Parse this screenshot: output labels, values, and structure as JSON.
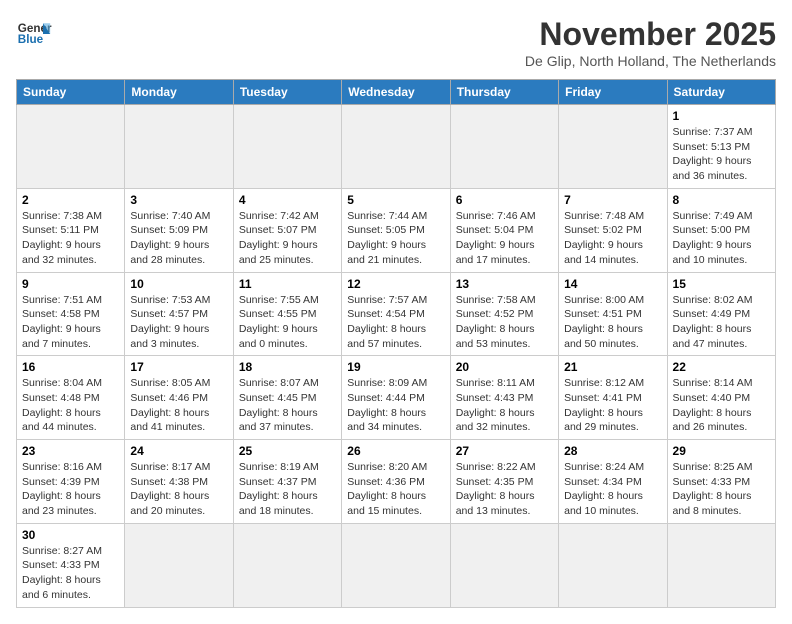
{
  "logo": {
    "text_general": "General",
    "text_blue": "Blue"
  },
  "header": {
    "title": "November 2025",
    "location": "De Glip, North Holland, The Netherlands"
  },
  "weekdays": [
    "Sunday",
    "Monday",
    "Tuesday",
    "Wednesday",
    "Thursday",
    "Friday",
    "Saturday"
  ],
  "days": {
    "d1": {
      "num": "1",
      "info": "Sunrise: 7:37 AM\nSunset: 5:13 PM\nDaylight: 9 hours and 36 minutes."
    },
    "d2": {
      "num": "2",
      "info": "Sunrise: 7:38 AM\nSunset: 5:11 PM\nDaylight: 9 hours and 32 minutes."
    },
    "d3": {
      "num": "3",
      "info": "Sunrise: 7:40 AM\nSunset: 5:09 PM\nDaylight: 9 hours and 28 minutes."
    },
    "d4": {
      "num": "4",
      "info": "Sunrise: 7:42 AM\nSunset: 5:07 PM\nDaylight: 9 hours and 25 minutes."
    },
    "d5": {
      "num": "5",
      "info": "Sunrise: 7:44 AM\nSunset: 5:05 PM\nDaylight: 9 hours and 21 minutes."
    },
    "d6": {
      "num": "6",
      "info": "Sunrise: 7:46 AM\nSunset: 5:04 PM\nDaylight: 9 hours and 17 minutes."
    },
    "d7": {
      "num": "7",
      "info": "Sunrise: 7:48 AM\nSunset: 5:02 PM\nDaylight: 9 hours and 14 minutes."
    },
    "d8": {
      "num": "8",
      "info": "Sunrise: 7:49 AM\nSunset: 5:00 PM\nDaylight: 9 hours and 10 minutes."
    },
    "d9": {
      "num": "9",
      "info": "Sunrise: 7:51 AM\nSunset: 4:58 PM\nDaylight: 9 hours and 7 minutes."
    },
    "d10": {
      "num": "10",
      "info": "Sunrise: 7:53 AM\nSunset: 4:57 PM\nDaylight: 9 hours and 3 minutes."
    },
    "d11": {
      "num": "11",
      "info": "Sunrise: 7:55 AM\nSunset: 4:55 PM\nDaylight: 9 hours and 0 minutes."
    },
    "d12": {
      "num": "12",
      "info": "Sunrise: 7:57 AM\nSunset: 4:54 PM\nDaylight: 8 hours and 57 minutes."
    },
    "d13": {
      "num": "13",
      "info": "Sunrise: 7:58 AM\nSunset: 4:52 PM\nDaylight: 8 hours and 53 minutes."
    },
    "d14": {
      "num": "14",
      "info": "Sunrise: 8:00 AM\nSunset: 4:51 PM\nDaylight: 8 hours and 50 minutes."
    },
    "d15": {
      "num": "15",
      "info": "Sunrise: 8:02 AM\nSunset: 4:49 PM\nDaylight: 8 hours and 47 minutes."
    },
    "d16": {
      "num": "16",
      "info": "Sunrise: 8:04 AM\nSunset: 4:48 PM\nDaylight: 8 hours and 44 minutes."
    },
    "d17": {
      "num": "17",
      "info": "Sunrise: 8:05 AM\nSunset: 4:46 PM\nDaylight: 8 hours and 41 minutes."
    },
    "d18": {
      "num": "18",
      "info": "Sunrise: 8:07 AM\nSunset: 4:45 PM\nDaylight: 8 hours and 37 minutes."
    },
    "d19": {
      "num": "19",
      "info": "Sunrise: 8:09 AM\nSunset: 4:44 PM\nDaylight: 8 hours and 34 minutes."
    },
    "d20": {
      "num": "20",
      "info": "Sunrise: 8:11 AM\nSunset: 4:43 PM\nDaylight: 8 hours and 32 minutes."
    },
    "d21": {
      "num": "21",
      "info": "Sunrise: 8:12 AM\nSunset: 4:41 PM\nDaylight: 8 hours and 29 minutes."
    },
    "d22": {
      "num": "22",
      "info": "Sunrise: 8:14 AM\nSunset: 4:40 PM\nDaylight: 8 hours and 26 minutes."
    },
    "d23": {
      "num": "23",
      "info": "Sunrise: 8:16 AM\nSunset: 4:39 PM\nDaylight: 8 hours and 23 minutes."
    },
    "d24": {
      "num": "24",
      "info": "Sunrise: 8:17 AM\nSunset: 4:38 PM\nDaylight: 8 hours and 20 minutes."
    },
    "d25": {
      "num": "25",
      "info": "Sunrise: 8:19 AM\nSunset: 4:37 PM\nDaylight: 8 hours and 18 minutes."
    },
    "d26": {
      "num": "26",
      "info": "Sunrise: 8:20 AM\nSunset: 4:36 PM\nDaylight: 8 hours and 15 minutes."
    },
    "d27": {
      "num": "27",
      "info": "Sunrise: 8:22 AM\nSunset: 4:35 PM\nDaylight: 8 hours and 13 minutes."
    },
    "d28": {
      "num": "28",
      "info": "Sunrise: 8:24 AM\nSunset: 4:34 PM\nDaylight: 8 hours and 10 minutes."
    },
    "d29": {
      "num": "29",
      "info": "Sunrise: 8:25 AM\nSunset: 4:33 PM\nDaylight: 8 hours and 8 minutes."
    },
    "d30": {
      "num": "30",
      "info": "Sunrise: 8:27 AM\nSunset: 4:33 PM\nDaylight: 8 hours and 6 minutes."
    }
  }
}
